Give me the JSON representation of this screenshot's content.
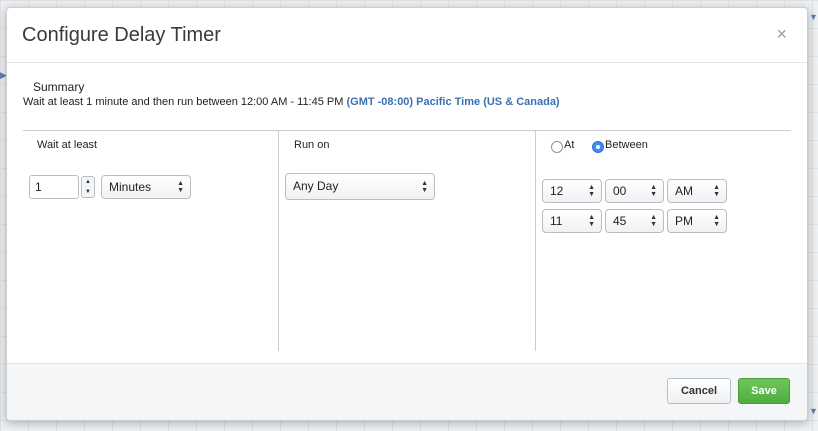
{
  "dialog": {
    "title": "Configure Delay Timer",
    "close_glyph": "×"
  },
  "summary": {
    "label": "Summary",
    "text": "Wait at least 1 minute and then run between 12:00 AM - 11:45 PM ",
    "timezone": "(GMT -08:00) Pacific Time (US & Canada)"
  },
  "wait": {
    "label": "Wait at least",
    "amount": "1",
    "unit": "Minutes"
  },
  "run_on": {
    "label": "Run on",
    "value": "Any Day"
  },
  "time": {
    "mode_at_label": "At",
    "mode_between_label": "Between",
    "selected_mode": "Between",
    "start": {
      "hour": "12",
      "minute": "00",
      "ampm": "AM"
    },
    "end": {
      "hour": "11",
      "minute": "45",
      "ampm": "PM"
    }
  },
  "footer": {
    "cancel_label": "Cancel",
    "save_label": "Save"
  },
  "colors": {
    "accent": "#3e8df3",
    "save": "#5cb85c",
    "timezone_link": "#3a6fb0"
  }
}
